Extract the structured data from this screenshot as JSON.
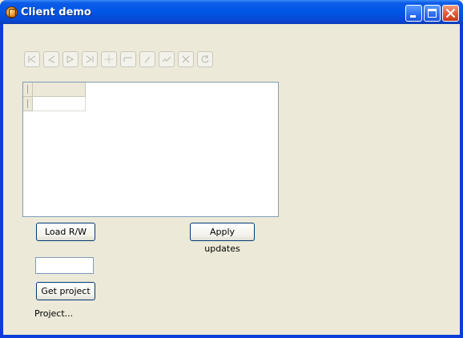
{
  "window": {
    "title": "Client demo"
  },
  "toolbar": {
    "tools": [
      {
        "icon": "first-record-icon"
      },
      {
        "icon": "prior-record-icon"
      },
      {
        "icon": "next-record-icon"
      },
      {
        "icon": "last-record-icon"
      },
      {
        "icon": "insert-record-icon"
      },
      {
        "icon": "delete-record-icon"
      },
      {
        "icon": "edit-record-icon"
      },
      {
        "icon": "post-record-icon"
      },
      {
        "icon": "cancel-edit-icon"
      },
      {
        "icon": "refresh-data-icon"
      }
    ]
  },
  "grid": {
    "columns": [
      ""
    ],
    "rows": [
      [
        ""
      ]
    ]
  },
  "actions": {
    "load_label": "Load R/W",
    "apply_label": "Apply updates",
    "get_project_label": "Get project"
  },
  "project_input": {
    "value": ""
  },
  "status": {
    "project_text": "Project..."
  }
}
